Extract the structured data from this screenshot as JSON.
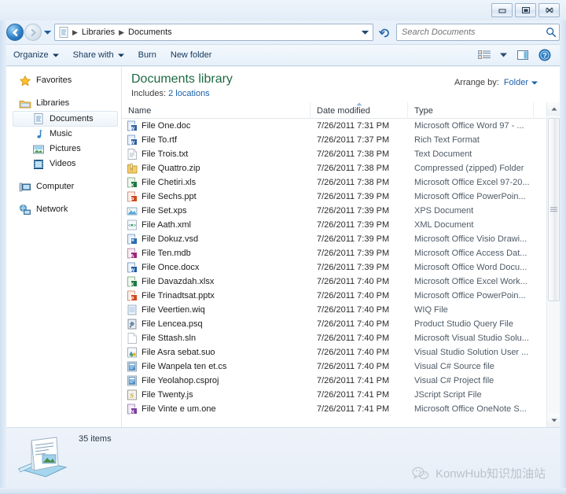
{
  "window": {
    "buttons": [
      {
        "name": "minimize",
        "glyph": "minimize-icon"
      },
      {
        "name": "maximize",
        "glyph": "maximize-icon"
      },
      {
        "name": "close",
        "glyph": "close-icon"
      }
    ]
  },
  "address": {
    "back_tooltip": "Back",
    "forward_tooltip": "Forward",
    "crumbs": [
      "Libraries",
      "Documents"
    ],
    "separator": "▶"
  },
  "search": {
    "placeholder": "Search Documents",
    "value": ""
  },
  "toolbar": {
    "items": [
      {
        "label": "Organize",
        "has_caret": true
      },
      {
        "label": "Share with",
        "has_caret": true
      },
      {
        "label": "Burn",
        "has_caret": false
      },
      {
        "label": "New folder",
        "has_caret": false
      }
    ],
    "right_icons": [
      "view-list-icon",
      "chevron-down-icon",
      "preview-pane-icon",
      "help-icon"
    ]
  },
  "sidebar": {
    "groups": [
      {
        "header": {
          "label": "Favorites",
          "icon": "star-icon"
        },
        "items": []
      },
      {
        "header": {
          "label": "Libraries",
          "icon": "libraries-folder-icon"
        },
        "items": [
          {
            "label": "Documents",
            "icon": "documents-icon",
            "selected": true
          },
          {
            "label": "Music",
            "icon": "music-icon",
            "selected": false
          },
          {
            "label": "Pictures",
            "icon": "pictures-icon",
            "selected": false
          },
          {
            "label": "Videos",
            "icon": "videos-icon",
            "selected": false
          }
        ]
      },
      {
        "header": {
          "label": "Computer",
          "icon": "computer-icon"
        },
        "items": []
      },
      {
        "header": {
          "label": "Network",
          "icon": "network-icon"
        },
        "items": []
      }
    ]
  },
  "library": {
    "title": "Documents library",
    "includes_label": "Includes:",
    "includes_link": "2 locations",
    "arrange_by_label": "Arrange by:",
    "arrange_by_value": "Folder"
  },
  "columns": [
    {
      "key": "name",
      "label": "Name",
      "sorted": false
    },
    {
      "key": "date",
      "label": "Date modified",
      "sorted": true,
      "direction": "asc"
    },
    {
      "key": "type",
      "label": "Type",
      "sorted": false
    }
  ],
  "files": [
    {
      "name": "File One.doc",
      "date": "7/26/2011 7:31 PM",
      "type": "Microsoft Office Word 97 - ...",
      "icon": "doc-icon"
    },
    {
      "name": "File To.rtf",
      "date": "7/26/2011 7:37 PM",
      "type": "Rich Text Format",
      "icon": "doc-icon"
    },
    {
      "name": "File Trois.txt",
      "date": "7/26/2011 7:38 PM",
      "type": "Text Document",
      "icon": "txt-icon"
    },
    {
      "name": "File Quattro.zip",
      "date": "7/26/2011 7:38 PM",
      "type": "Compressed (zipped) Folder",
      "icon": "zip-icon"
    },
    {
      "name": "File Chetiri.xls",
      "date": "7/26/2011 7:38 PM",
      "type": "Microsoft Office Excel 97-20...",
      "icon": "xls-icon"
    },
    {
      "name": "File Sechs.ppt",
      "date": "7/26/2011 7:39 PM",
      "type": "Microsoft Office PowerPoin...",
      "icon": "ppt-icon"
    },
    {
      "name": "File Set.xps",
      "date": "7/26/2011 7:39 PM",
      "type": "XPS Document",
      "icon": "xps-icon"
    },
    {
      "name": "File Aath.xml",
      "date": "7/26/2011 7:39 PM",
      "type": "XML Document",
      "icon": "xml-icon"
    },
    {
      "name": "File Dokuz.vsd",
      "date": "7/26/2011 7:39 PM",
      "type": "Microsoft Office Visio Drawi...",
      "icon": "vsd-icon"
    },
    {
      "name": "File Ten.mdb",
      "date": "7/26/2011 7:39 PM",
      "type": "Microsoft Office Access Dat...",
      "icon": "mdb-icon"
    },
    {
      "name": "File Once.docx",
      "date": "7/26/2011 7:39 PM",
      "type": "Microsoft Office Word Docu...",
      "icon": "docx-icon"
    },
    {
      "name": "File Davazdah.xlsx",
      "date": "7/26/2011 7:40 PM",
      "type": "Microsoft Office Excel Work...",
      "icon": "xlsx-icon"
    },
    {
      "name": "File Trinadtsat.pptx",
      "date": "7/26/2011 7:40 PM",
      "type": "Microsoft Office PowerPoin...",
      "icon": "pptx-icon"
    },
    {
      "name": "File Veertien.wiq",
      "date": "7/26/2011 7:40 PM",
      "type": "WIQ File",
      "icon": "wiq-icon"
    },
    {
      "name": "File Lencea.psq",
      "date": "7/26/2011 7:40 PM",
      "type": "Product Studio Query File",
      "icon": "psq-icon"
    },
    {
      "name": "File Sttash.sln",
      "date": "7/26/2011 7:40 PM",
      "type": "Microsoft Visual Studio Solu...",
      "icon": "blank-icon"
    },
    {
      "name": "File Asra sebat.suo",
      "date": "7/26/2011 7:40 PM",
      "type": "Visual Studio Solution User ...",
      "icon": "suo-icon"
    },
    {
      "name": "File Wanpela ten et.cs",
      "date": "7/26/2011 7:40 PM",
      "type": "Visual C# Source file",
      "icon": "cs-icon"
    },
    {
      "name": "File Yeolahop.csproj",
      "date": "7/26/2011 7:41 PM",
      "type": "Visual C# Project file",
      "icon": "cs-icon"
    },
    {
      "name": "File Twenty.js",
      "date": "7/26/2011 7:41 PM",
      "type": "JScript Script File",
      "icon": "js-icon"
    },
    {
      "name": "File Vinte e um.one",
      "date": "7/26/2011 7:41 PM",
      "type": "Microsoft Office OneNote S...",
      "icon": "one-icon"
    }
  ],
  "status": {
    "item_count": "35 items"
  },
  "watermark": {
    "text": "KonwHub知识加油站",
    "icon": "wechat-icon"
  },
  "colors": {
    "library_title": "#1e6a43",
    "link": "#1a5fa8",
    "frame": "#dfeaf7"
  }
}
